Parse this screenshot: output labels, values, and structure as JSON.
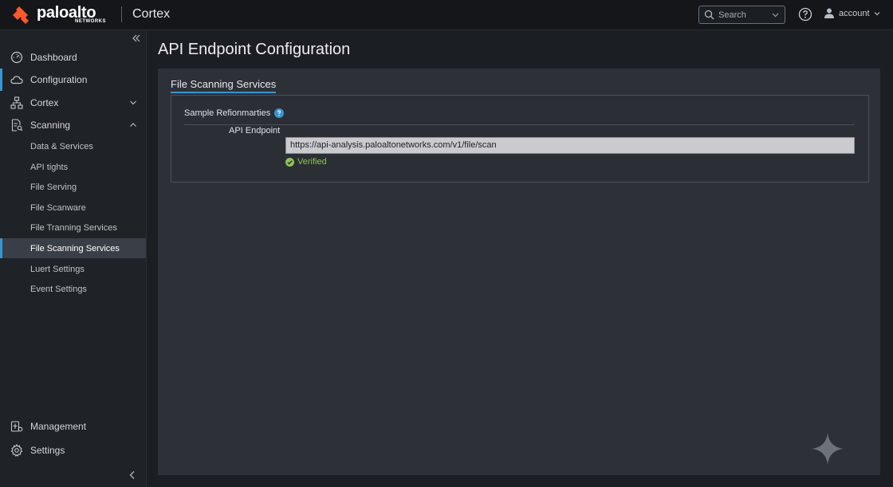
{
  "header": {
    "brand": "paloalto",
    "brand_sub": "NETWORKS",
    "product": "Cortex",
    "search_placeholder": "Search",
    "account_label": "account",
    "icons": [
      "search-icon",
      "help-icon",
      "user-icon"
    ]
  },
  "sidebar": {
    "items": [
      {
        "label": "Dashboard",
        "icon": "dashboard-icon"
      },
      {
        "label": "Configuration",
        "icon": "cloud-icon"
      },
      {
        "label": "Cortex",
        "icon": "hierarchy-icon",
        "expanded": false
      },
      {
        "label": "Scanning",
        "icon": "document-scan-icon",
        "expanded": true
      }
    ],
    "subitems": [
      {
        "label": "Data & Services"
      },
      {
        "label": "API tights"
      },
      {
        "label": "File Serving"
      },
      {
        "label": "File Scanware"
      },
      {
        "label": "File Tranning Services"
      },
      {
        "label": "File Scanning Services",
        "selected": true
      },
      {
        "label": "Luert Settings"
      },
      {
        "label": "Event Settings"
      }
    ],
    "bottom_items": [
      {
        "label": "Management",
        "icon": "management-icon"
      },
      {
        "label": "Settings",
        "icon": "gear-icon"
      }
    ]
  },
  "main": {
    "title": "API Endpoint Configuration",
    "tab": "File Scanning Services",
    "section_label": "Sample Refionmarties",
    "field_label": "API Endpoint",
    "endpoint_value": "https://api-analysis.paloaltonetworks.com/v1/file/scan",
    "status": "Verified"
  },
  "colors": {
    "accent": "#3a94d0",
    "brand": "#fa582d",
    "verified": "#8dc356",
    "background": "#1b1e23",
    "panel": "#2d3137"
  }
}
